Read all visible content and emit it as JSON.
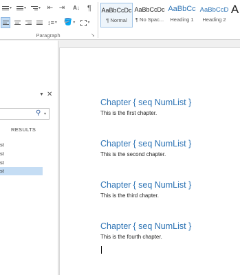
{
  "ribbon": {
    "paragraph_group_label": "Paragraph",
    "styles": [
      {
        "sample": "AaBbCcDc",
        "name": "¶ Normal",
        "active": true
      },
      {
        "sample": "AaBbCcDc",
        "name": "¶ No Spac...",
        "active": false
      },
      {
        "sample": "AaBbCc",
        "name": "Heading 1",
        "active": false
      },
      {
        "sample": "AaBbCcD",
        "name": "Heading 2",
        "active": false
      },
      {
        "sample": "A",
        "name": "",
        "active": false
      }
    ],
    "sort_glyph": "A↓",
    "pilcrow_glyph": "¶"
  },
  "nav": {
    "results_tab": "RESULTS",
    "items": [
      {
        "label": "st",
        "selected": false
      },
      {
        "label": "st",
        "selected": false
      },
      {
        "label": "st",
        "selected": false
      },
      {
        "label": "st",
        "selected": true
      }
    ]
  },
  "document": {
    "chapters": [
      {
        "title": "Chapter",
        "field": "{ seq NumList }",
        "body": "This is the first chapter."
      },
      {
        "title": "Chapter",
        "field": "{ seq NumList }",
        "body": "This is the second chapter."
      },
      {
        "title": "Chapter",
        "field": "{ seq NumList }",
        "body": "This is the third chapter."
      },
      {
        "title": "Chapter",
        "field": "{ seq NumList }",
        "body": "This is the fourth chapter."
      }
    ]
  },
  "colors": {
    "heading": "#2e74b5",
    "selection": "#c5ddf4",
    "accent": "#2b579a"
  }
}
